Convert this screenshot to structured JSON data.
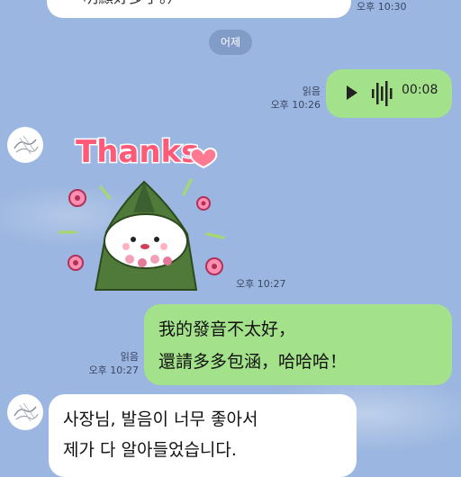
{
  "top_bubble": {
    "text": "明顯好多了。）",
    "time": "오후 10:30"
  },
  "date_separator": "어제",
  "voice_message": {
    "read": "읽음",
    "time": "오후 10:26",
    "duration": "00:08"
  },
  "sticker": {
    "text": "Thanks",
    "time": "오후 10:27"
  },
  "sent_message": {
    "lines": [
      "我的發音不太好，",
      "還請多多包涵，哈哈哈！"
    ],
    "read": "읽음",
    "time": "오후 10:27"
  },
  "received_message": {
    "lines": [
      "사장님, 발음이 너무 좋아서",
      "제가 다 알아들었습니다."
    ]
  },
  "colors": {
    "background": "#9bb6e0",
    "sent_bubble": "#a3e28a",
    "received_bubble": "#ffffff"
  }
}
